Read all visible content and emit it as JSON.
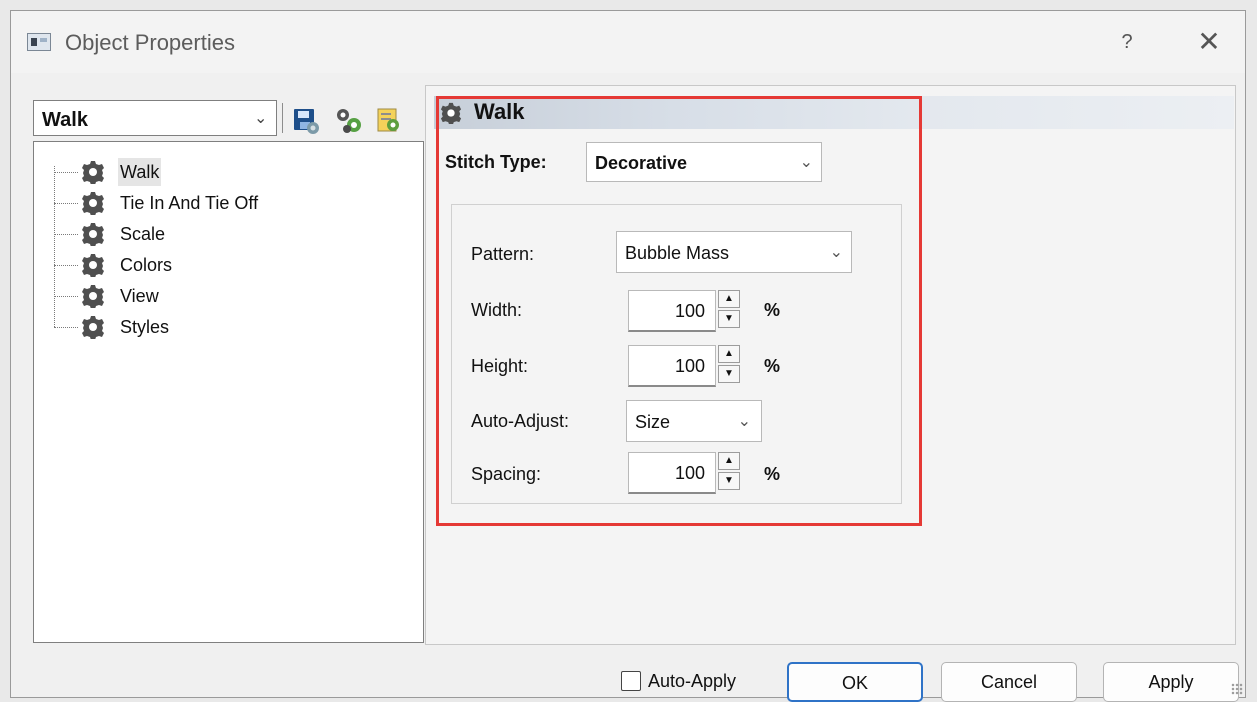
{
  "window": {
    "title": "Object Properties",
    "help_label": "?",
    "close_label": "✕"
  },
  "left": {
    "object_select_value": "Walk",
    "toolbar": {
      "save_icon": "save-icon",
      "props_icon": "gear-properties-icon",
      "new_icon": "document-settings-icon"
    },
    "tree_items": [
      {
        "label": "Walk",
        "icon": "gear-icon"
      },
      {
        "label": "Tie In And Tie Off",
        "icon": "gear-icon"
      },
      {
        "label": "Scale",
        "icon": "gear-icon"
      },
      {
        "label": "Colors",
        "icon": "gear-icon"
      },
      {
        "label": "View",
        "icon": "gear-icon"
      },
      {
        "label": "Styles",
        "icon": "gear-icon"
      }
    ]
  },
  "right": {
    "header_title": "Walk",
    "stitch_type_label": "Stitch Type:",
    "stitch_type_value": "Decorative",
    "pattern_label": "Pattern:",
    "pattern_value": "Bubble Mass",
    "width_label": "Width:",
    "width_value": "100",
    "width_unit": "%",
    "height_label": "Height:",
    "height_value": "100",
    "height_unit": "%",
    "auto_adjust_label": "Auto-Adjust:",
    "auto_adjust_value": "Size",
    "spacing_label": "Spacing:",
    "spacing_value": "100",
    "spacing_unit": "%"
  },
  "bottom": {
    "auto_apply_label": "Auto-Apply",
    "auto_apply_checked": false,
    "ok_label": "OK",
    "cancel_label": "Cancel",
    "apply_label": "Apply"
  },
  "colors": {
    "highlight": "#e53935",
    "ok_border": "#2f73c7"
  }
}
